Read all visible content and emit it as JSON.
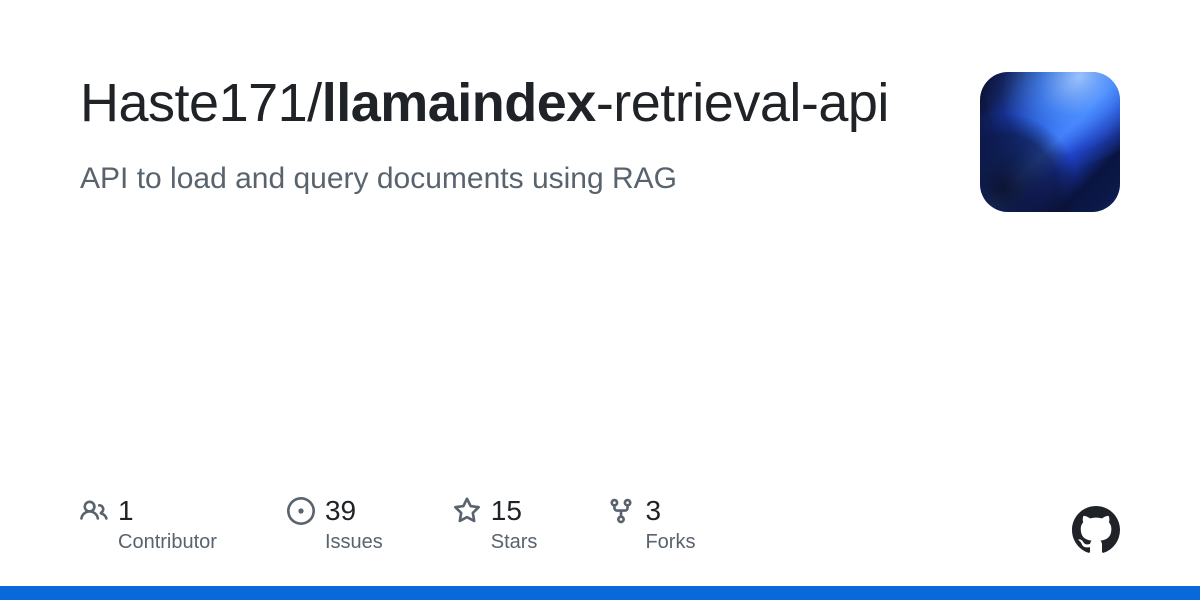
{
  "repo": {
    "owner": "Haste171",
    "separator": "/",
    "name_bold": "llamaindex",
    "name_hyphen1": "-",
    "name_mid": "retrieval",
    "name_hyphen2": "-",
    "name_end": "api",
    "description": "API to load and query documents using RAG"
  },
  "stats": {
    "contributors": {
      "count": "1",
      "label": "Contributor"
    },
    "issues": {
      "count": "39",
      "label": "Issues"
    },
    "stars": {
      "count": "15",
      "label": "Stars"
    },
    "forks": {
      "count": "3",
      "label": "Forks"
    }
  }
}
